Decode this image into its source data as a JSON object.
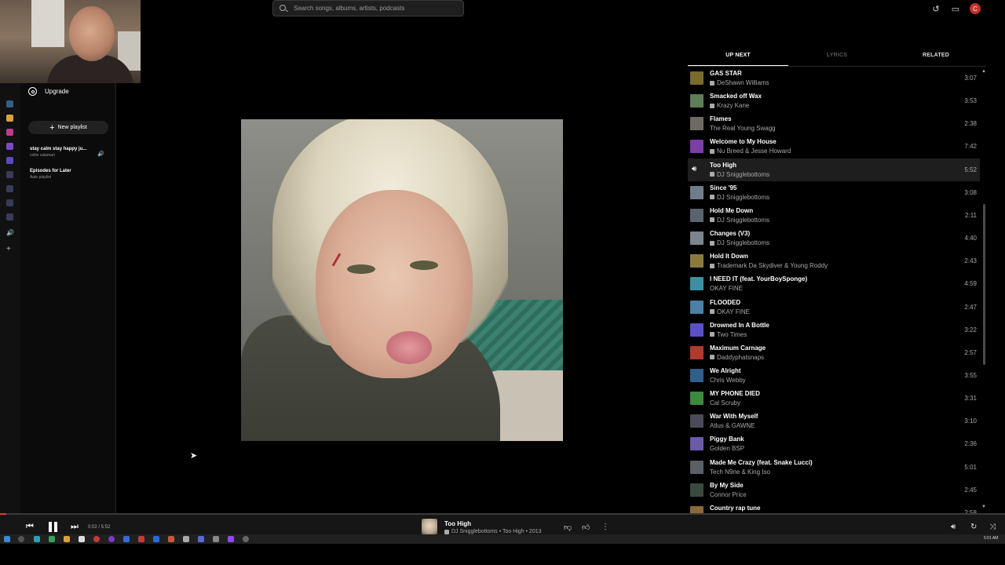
{
  "search": {
    "placeholder": "Search songs, albums, artists, podcasts"
  },
  "header": {
    "avatar_letter": "C"
  },
  "sidebar": {
    "upgrade_label": "Upgrade",
    "new_playlist_label": "New playlist",
    "playlists": [
      {
        "title": "stay calm stay happy ju...",
        "subtitle": "collin calamari"
      },
      {
        "title": "Episodes for Later",
        "subtitle": "Auto playlist"
      }
    ]
  },
  "tabs": {
    "up_next": "UP NEXT",
    "lyrics": "LYRICS",
    "related": "RELATED"
  },
  "queue": [
    {
      "title": "GAS STAR",
      "artist": "DeShawn Williams",
      "explicit": true,
      "duration": "3:07",
      "thumb": "#7a6a2e"
    },
    {
      "title": "Smacked off Wax",
      "artist": "Krazy Kane",
      "explicit": true,
      "duration": "3:53",
      "thumb": "#5f7d56"
    },
    {
      "title": "Flames",
      "artist": "The Real Young Swagg",
      "explicit": false,
      "duration": "2:38",
      "thumb": "#6d6a63"
    },
    {
      "title": "Welcome to My House",
      "artist": "Nu Breed & Jesse Howard",
      "explicit": true,
      "duration": "7:42",
      "thumb": "#7b3fa8"
    },
    {
      "title": "Too High",
      "artist": "DJ Snigglebottoms",
      "explicit": true,
      "duration": "5:52",
      "thumb": "#c9b7a2",
      "active": true
    },
    {
      "title": "Since '95",
      "artist": "DJ Snigglebottoms",
      "explicit": true,
      "duration": "3:08",
      "thumb": "#6f7d8a"
    },
    {
      "title": "Hold Me Down",
      "artist": "DJ Snigglebottoms",
      "explicit": true,
      "duration": "2:11",
      "thumb": "#5a6470"
    },
    {
      "title": "Changes (V3)",
      "artist": "DJ Snigglebottoms",
      "explicit": true,
      "duration": "4:40",
      "thumb": "#7a848c"
    },
    {
      "title": "Hold It Down",
      "artist": "Trademark Da Skydiver & Young Roddy",
      "explicit": true,
      "duration": "2:43",
      "thumb": "#8a7a3c"
    },
    {
      "title": "I NEED IT (feat. YourBoySponge)",
      "artist": "OKAY FINE",
      "explicit": false,
      "duration": "4:59",
      "thumb": "#3d8fa3"
    },
    {
      "title": "FLOODED",
      "artist": "OKAY FINE",
      "explicit": true,
      "duration": "2:47",
      "thumb": "#4a7fa6"
    },
    {
      "title": "Drowned In A Bottle",
      "artist": "Two Times",
      "explicit": true,
      "duration": "3:22",
      "thumb": "#5a4fc7"
    },
    {
      "title": "Maximum Carnage",
      "artist": "Daddyphatsnaps",
      "explicit": true,
      "duration": "2:57",
      "thumb": "#b03a2e"
    },
    {
      "title": "We Alright",
      "artist": "Chris Webby",
      "explicit": false,
      "duration": "3:55",
      "thumb": "#2f5f8a"
    },
    {
      "title": "MY PHONE DIED",
      "artist": "Cal Scruby",
      "explicit": false,
      "duration": "3:31",
      "thumb": "#3b8a3e"
    },
    {
      "title": "War With Myself",
      "artist": "Atlus & GAWNE",
      "explicit": false,
      "duration": "3:10",
      "thumb": "#4a4a58"
    },
    {
      "title": "Piggy Bank",
      "artist": "Golden BSP",
      "explicit": false,
      "duration": "2:36",
      "thumb": "#6a5aa8"
    },
    {
      "title": "Made Me Crazy (feat. Snake Lucci)",
      "artist": "Tech N9ne & King Iso",
      "explicit": false,
      "duration": "5:01",
      "thumb": "#5b5f66"
    },
    {
      "title": "By My Side",
      "artist": "Connor Price",
      "explicit": false,
      "duration": "2:45",
      "thumb": "#3a4a3f"
    },
    {
      "title": "Country rap tune",
      "artist": "",
      "explicit": false,
      "duration": "2:58",
      "thumb": "#8a6a3a"
    }
  ],
  "player": {
    "timecode": "0:02 / 5:52",
    "progress": 0.006,
    "now_playing_title": "Too High",
    "now_playing_sub": "DJ Snigglebottoms • Too High • 2013"
  },
  "taskbar": {
    "clock": "5:01 AM"
  },
  "colors": {
    "accent": "#e53935",
    "background": "#000000",
    "active_row": "#1e1e1e"
  }
}
